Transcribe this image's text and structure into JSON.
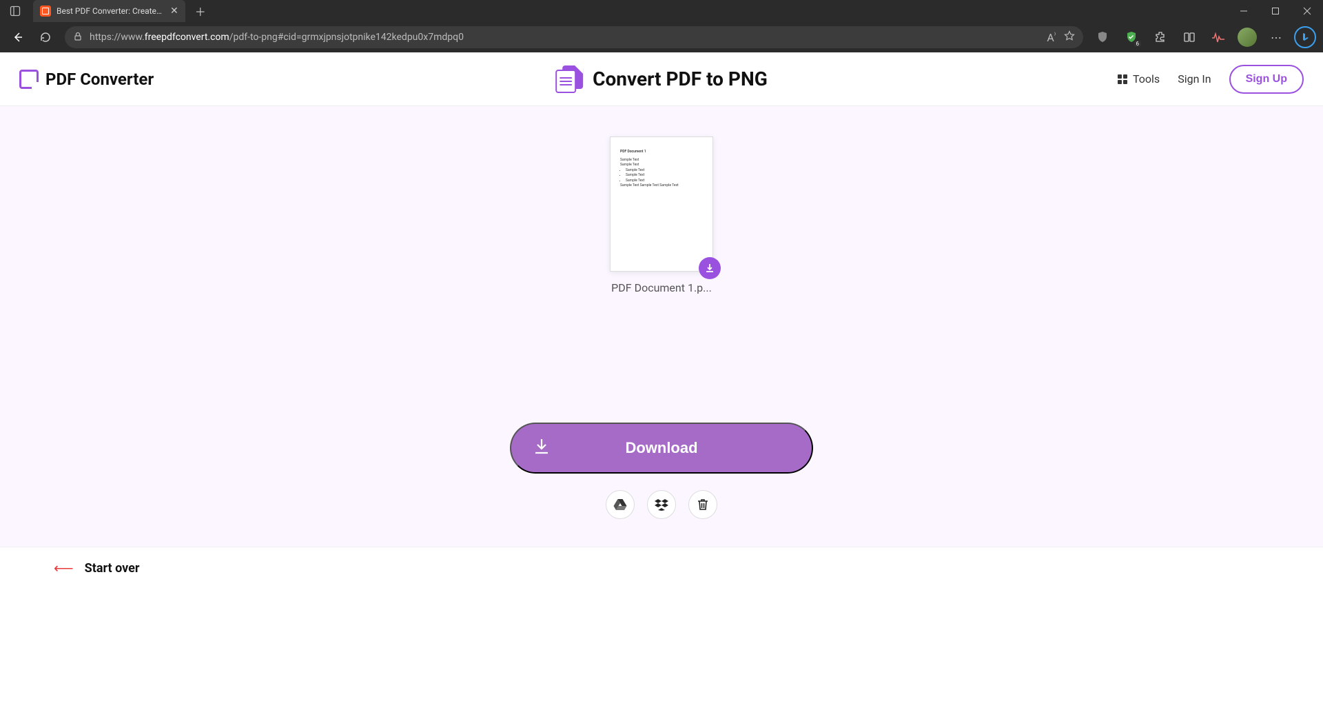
{
  "browser": {
    "tab_title": "Best PDF Converter: Create, Conv",
    "url_display_prefix": "https://www.",
    "url_display_domain": "freepdfconvert.com",
    "url_display_path": "/pdf-to-png#cid=grmxjpnsjotpnike142kedpu0x7mdpq0",
    "ext_badge": "6"
  },
  "site": {
    "logo_text": "PDF Converter",
    "page_title": "Convert PDF to PNG",
    "tools_label": "Tools",
    "signin_label": "Sign In",
    "signup_label": "Sign Up"
  },
  "result": {
    "filename": "PDF Document 1.p...",
    "preview": {
      "title": "PDF Document 1",
      "line1": "Sample Text",
      "line2": "Sample Text",
      "bullets": [
        "Sample Text",
        "Sample Text",
        "Sample Text"
      ],
      "footer": "Sample Text Sample Text Sample Text"
    }
  },
  "actions": {
    "download_label": "Download",
    "start_over_label": "Start over"
  }
}
